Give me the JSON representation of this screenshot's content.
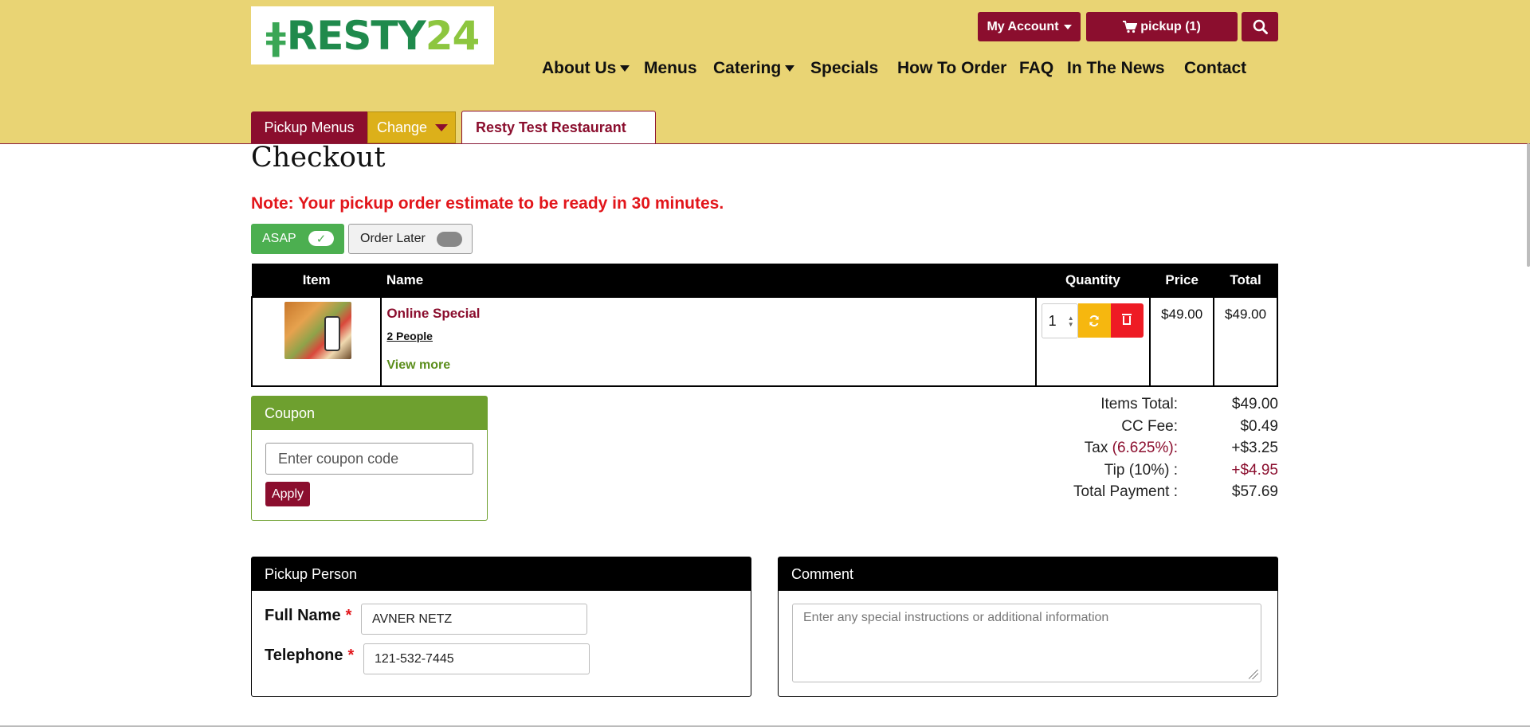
{
  "brand": {
    "logo_part1": "RESTY",
    "logo_part2": "24"
  },
  "header": {
    "account_label": "My Account",
    "cart_label": "pickup (1)"
  },
  "nav": [
    {
      "label": "About Us",
      "has_dropdown": true
    },
    {
      "label": "Menus",
      "has_dropdown": false
    },
    {
      "label": "Catering",
      "has_dropdown": true
    },
    {
      "label": "Specials",
      "has_dropdown": false
    },
    {
      "label": "How To Order",
      "has_dropdown": false
    },
    {
      "label": "FAQ",
      "has_dropdown": false
    },
    {
      "label": "In The News",
      "has_dropdown": false
    },
    {
      "label": "Contact",
      "has_dropdown": false
    }
  ],
  "menu_bar": {
    "pickup_menus": "Pickup Menus",
    "change": "Change",
    "restaurant": "Resty Test Restaurant"
  },
  "page": {
    "title": "Checkout",
    "note": "Note: Your pickup order estimate to be ready in 30 minutes."
  },
  "timing": {
    "asap_label": "ASAP",
    "asap_check": "✓",
    "later_label": "Order Later",
    "asap_selected": true
  },
  "cart": {
    "headers": {
      "item": "Item",
      "name": "Name",
      "quantity": "Quantity",
      "price": "Price",
      "total": "Total"
    },
    "rows": [
      {
        "name": "Online Special",
        "option": "2 People",
        "more": "View more",
        "quantity": "1",
        "price": "$49.00",
        "total": "$49.00"
      }
    ]
  },
  "coupon": {
    "title": "Coupon",
    "placeholder": "Enter coupon code",
    "apply": "Apply"
  },
  "totals": {
    "items_label": "Items Total:",
    "items_value": "$49.00",
    "cc_label": "CC Fee:",
    "cc_value": "$0.49",
    "tax_label": "Tax",
    "tax_rate": "(6.625%):",
    "tax_value": "+$3.25",
    "tip_label": "Tip (10%) :",
    "tip_value": "+$4.95",
    "payment_label": "Total Payment :",
    "payment_value": "$57.69"
  },
  "pickup_person": {
    "title": "Pickup Person",
    "name_label": "Full Name",
    "name_value": "AVNER NETZ",
    "phone_label": "Telephone",
    "phone_value": "121-532-7445",
    "required_mark": "*"
  },
  "comment": {
    "title": "Comment",
    "placeholder": "Enter any special instructions or additional information"
  },
  "colors": {
    "header_bg": "#e9d474",
    "brand_maroon": "#8b0e2e",
    "change_gold": "#dcb01a",
    "asap_green": "#4caf50",
    "coupon_green": "#6ea02f",
    "note_red": "#e2161b"
  },
  "icons": {
    "cart": "shopping-cart-icon",
    "search": "search-icon",
    "refresh": "refresh-icon",
    "delete": "trash-icon"
  }
}
